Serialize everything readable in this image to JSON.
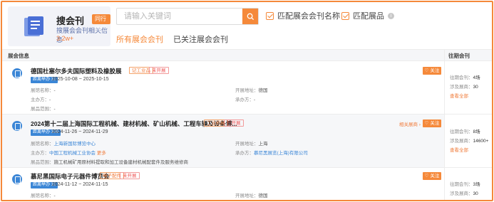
{
  "header": {
    "app_title": "搜会刊",
    "app_subtitle": "搜展会会刊相关信息",
    "app_count": "3.2w+",
    "hot_badge": "同行热门",
    "search_placeholder": "请输入关键词",
    "match_title_label": "匹配展会会刊名称",
    "match_products_label": "匹配展品",
    "tabs": [
      "所有展会会刊",
      "已关注展会会刊"
    ]
  },
  "table": {
    "col_left": "展会信息",
    "col_right": "往期会刊"
  },
  "rows": [
    {
      "title": "德国杜塞尔多夫国际塑料及橡胶展",
      "tags": [
        "记工业品",
        "未开展"
      ],
      "date_badge": "距离举办 13",
      "dates": "2025-10-08 ~ 2025-10-15",
      "venue_label": "展馆名称：",
      "venue": "-",
      "address_label": "开展地址：",
      "address": "德国",
      "organizer_label": "主办方：",
      "organizer": "-",
      "undertaker_label": "承办方：",
      "undertaker": "-",
      "scope_label": "展品范围：",
      "scope": "-",
      "follow": "关注",
      "history_label": "往期会刊：",
      "history": "4场",
      "match_label": "涉及展商：",
      "match": "30",
      "view_all": "查看全部"
    },
    {
      "title": "2024第十二届上海国际工程机械、建材机械、矿山机械、工程车辆及设备博...",
      "tags": [
        "工业机械",
        "已开展"
      ],
      "date_badge": "距离举办 100",
      "dates": "2024-11-26 ~ 2024-11-29",
      "venue_label": "展馆名称：",
      "venue": "上海新国际博览中心",
      "address_label": "开展地址：",
      "address": "上海",
      "organizer_label": "主办方：",
      "organizer": "中国工程机械工业协会",
      "organizer_more": "更多",
      "undertaker_label": "承办方：",
      "undertaker": "慕尼黑展览(上海)有限公司",
      "scope_label": "展品范围：",
      "scope": "施工机械矿用原材料提取和加工设备建材机械配套件及服务维修商",
      "exhibit_link": "相关展商",
      "follow": "关注",
      "history_label": "往期会刊：",
      "history": "8场",
      "match_label": "涉及展商：",
      "match": "14600+",
      "view_all": "查看全部"
    },
    {
      "title": "慕尼黑国际电子元器件博览会",
      "tags": [
        "电子配件",
        "未开展"
      ],
      "date_badge": "距离举办 15",
      "dates": "2024-11-12 ~ 2024-11-15",
      "venue_label": "展馆名称：",
      "venue": "-",
      "address_label": "开展地址：",
      "address": "德国",
      "follow": "关注",
      "history_label": "往期会刊：",
      "history": "3场",
      "match_label": "涉及展商：",
      "match": "30"
    }
  ],
  "colors": {
    "accent": "#f5893a",
    "blue": "#3b86d6"
  }
}
